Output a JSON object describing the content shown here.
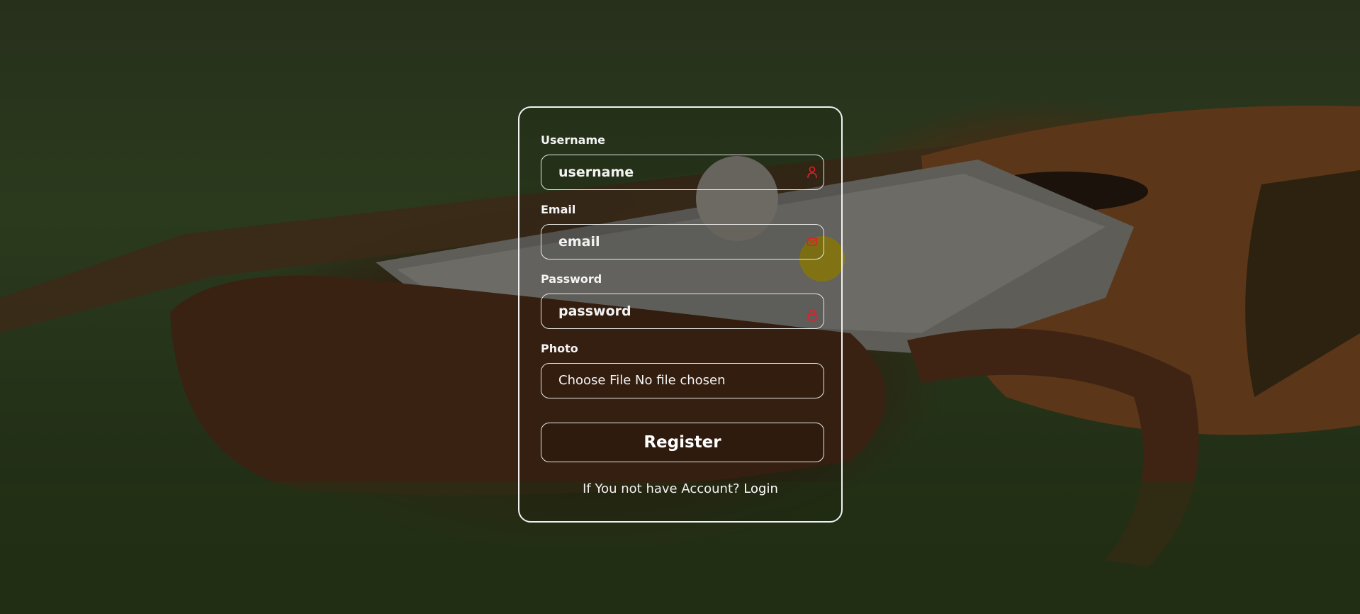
{
  "form": {
    "username": {
      "label": "Username",
      "placeholder": "username",
      "icon": "person-icon"
    },
    "email": {
      "label": "Email",
      "placeholder": "email",
      "icon": "envelope-icon"
    },
    "password": {
      "label": "Password",
      "placeholder": "password",
      "icon": "lock-icon"
    },
    "photo": {
      "label": "Photo",
      "file_button": "Choose File",
      "file_status": "No file chosen"
    },
    "submit_label": "Register",
    "footer_text": "If You not have Account?",
    "footer_link": "Login"
  },
  "colors": {
    "icon": "#e0202a",
    "border": "#f2f2f2",
    "text": "#ffffff"
  }
}
